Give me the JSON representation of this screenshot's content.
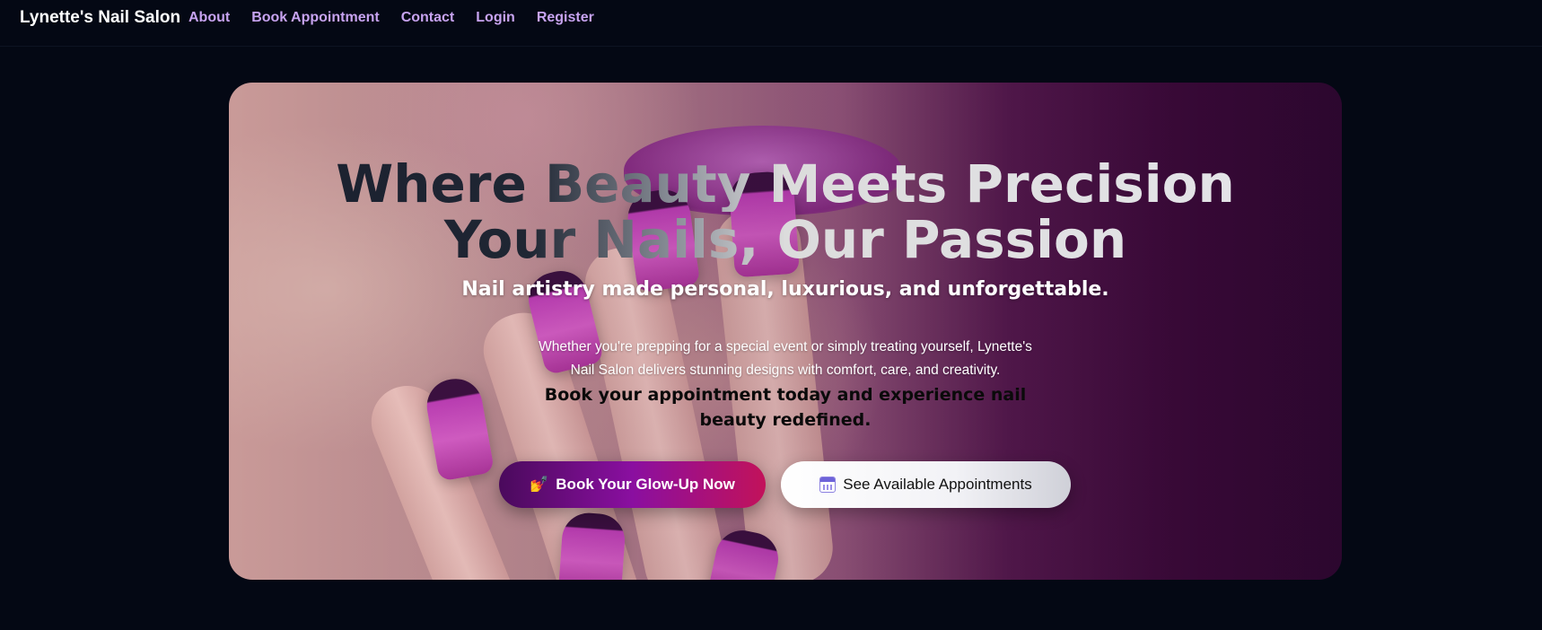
{
  "navbar": {
    "brand": "Lynette's Nail Salon",
    "links": [
      "About",
      "Book Appointment",
      "Contact",
      "Login",
      "Register"
    ]
  },
  "hero": {
    "headline_line1": "Where Beauty Meets Precision",
    "headline_line2": "Your Nails, Our Passion",
    "tagline": "Nail artistry made personal, luxurious, and unforgettable.",
    "description": "Whether you're prepping for a special event or simply treating yourself, Lynette's Nail Salon delivers stunning designs with comfort, care, and creativity.",
    "cta_text": "Book your appointment today and experience nail beauty redefined.",
    "primary_button": {
      "icon": "💅",
      "label": "Book Your Glow-Up Now"
    },
    "secondary_button": {
      "icon": "calendar-icon",
      "label": "See Available Appointments"
    }
  },
  "colors": {
    "background": "#040814",
    "nav_link": "#c7a3f0",
    "primary_gradient_start": "#4a0a5c",
    "primary_gradient_end": "#c2125a"
  }
}
